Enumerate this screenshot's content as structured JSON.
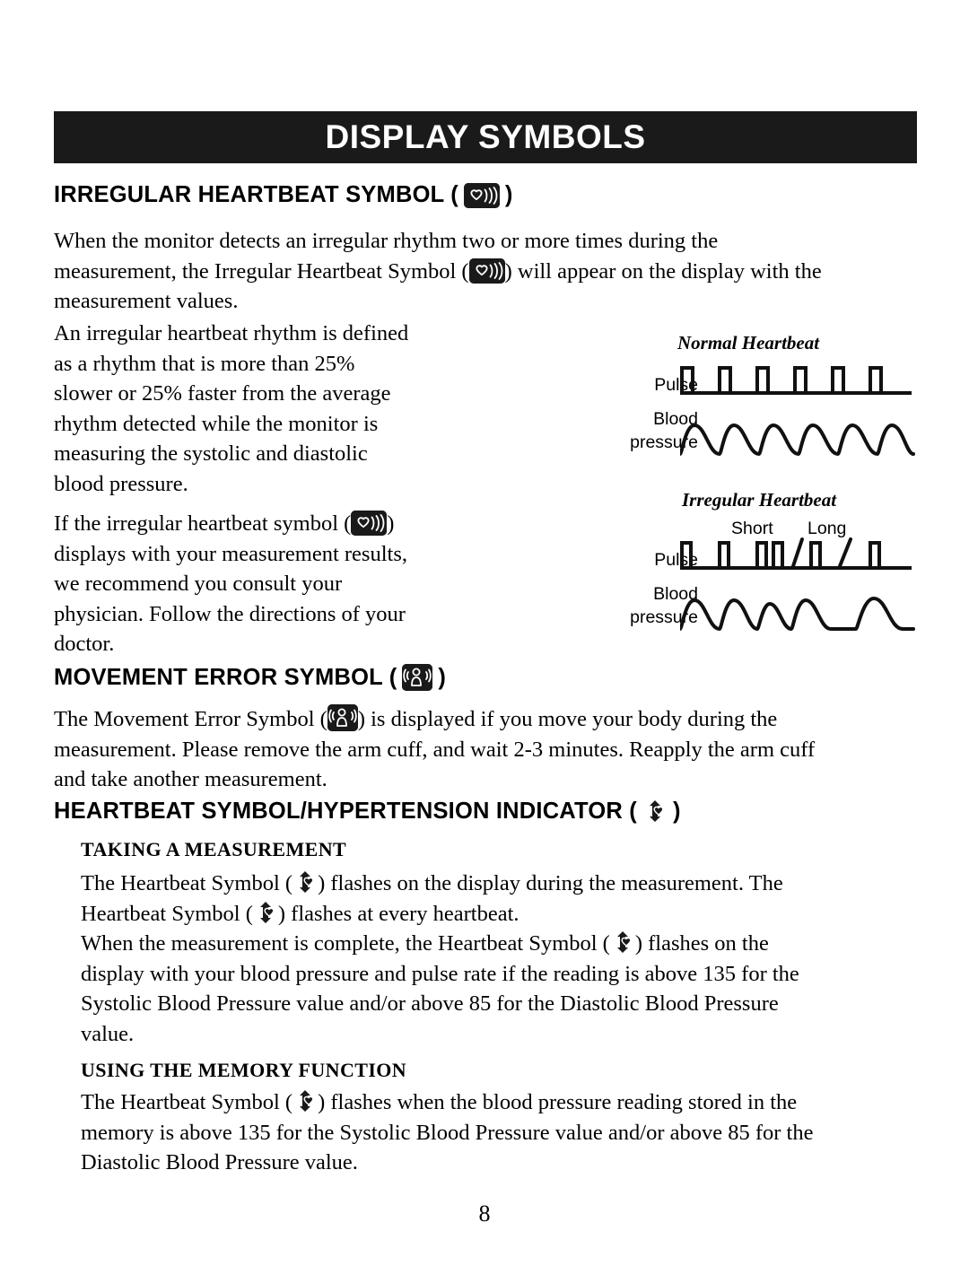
{
  "banner": {
    "title": "DISPLAY SYMBOLS"
  },
  "sections": {
    "irregular": {
      "heading_pre": "IRREGULAR HEARTBEAT SYMBOL (",
      "heading_post": ")",
      "p1": [
        "When the monitor detects an irregular rhythm two or more times during the",
        "measurement, the Irregular Heartbeat Symbol (",
        ") will appear on the display with the",
        "measurement values."
      ],
      "p2": [
        "An irregular heartbeat rhythm is defined",
        "as a rhythm that is more than 25%",
        "slower or 25% faster from the average",
        "rhythm detected while the monitor is",
        "measuring the systolic and diastolic",
        "blood pressure."
      ],
      "p3": [
        "If the irregular heartbeat symbol (",
        ")",
        "displays with your measurement results,",
        "we recommend you consult your",
        "physician. Follow the directions of your",
        "doctor."
      ]
    },
    "movement": {
      "heading_pre": "MOVEMENT ERROR SYMBOL (",
      "heading_post": ")",
      "p1": [
        "The Movement Error Symbol (",
        ") is displayed if you move your body during the",
        "measurement. Please remove the arm cuff, and wait 2-3 minutes. Reapply the arm cuff",
        "and take another measurement."
      ]
    },
    "heartbeat": {
      "heading_pre": "HEARTBEAT SYMBOL/HYPERTENSION INDICATOR (",
      "heading_post": ")",
      "sub1": "TAKING A MEASUREMENT",
      "p1": [
        "The Heartbeat Symbol (",
        ") flashes on the display during the measurement. The",
        "Heartbeat Symbol (",
        ") flashes at every heartbeat."
      ],
      "p2": [
        "When the measurement is complete, the Heartbeat Symbol (",
        ") flashes on the",
        "display with your blood pressure and pulse rate if the reading is above 135 for the",
        "Systolic Blood Pressure value and/or above 85 for the Diastolic Blood Pressure",
        "value."
      ],
      "sub2": "USING THE MEMORY FUNCTION",
      "p3": [
        "The Heartbeat Symbol (",
        ") flashes when the blood pressure reading stored in the",
        "memory is above 135 for the Systolic Blood Pressure value and/or above 85 for the",
        "Diastolic Blood Pressure value."
      ]
    }
  },
  "figure": {
    "normal_caption": "Normal Heartbeat",
    "irregular_caption": "Irregular Heartbeat",
    "pulse_label": "Pulse",
    "blood_label": "Blood",
    "pressure_label": "pressure",
    "short_label": "Short",
    "long_label": "Long"
  },
  "page_number": "8"
}
